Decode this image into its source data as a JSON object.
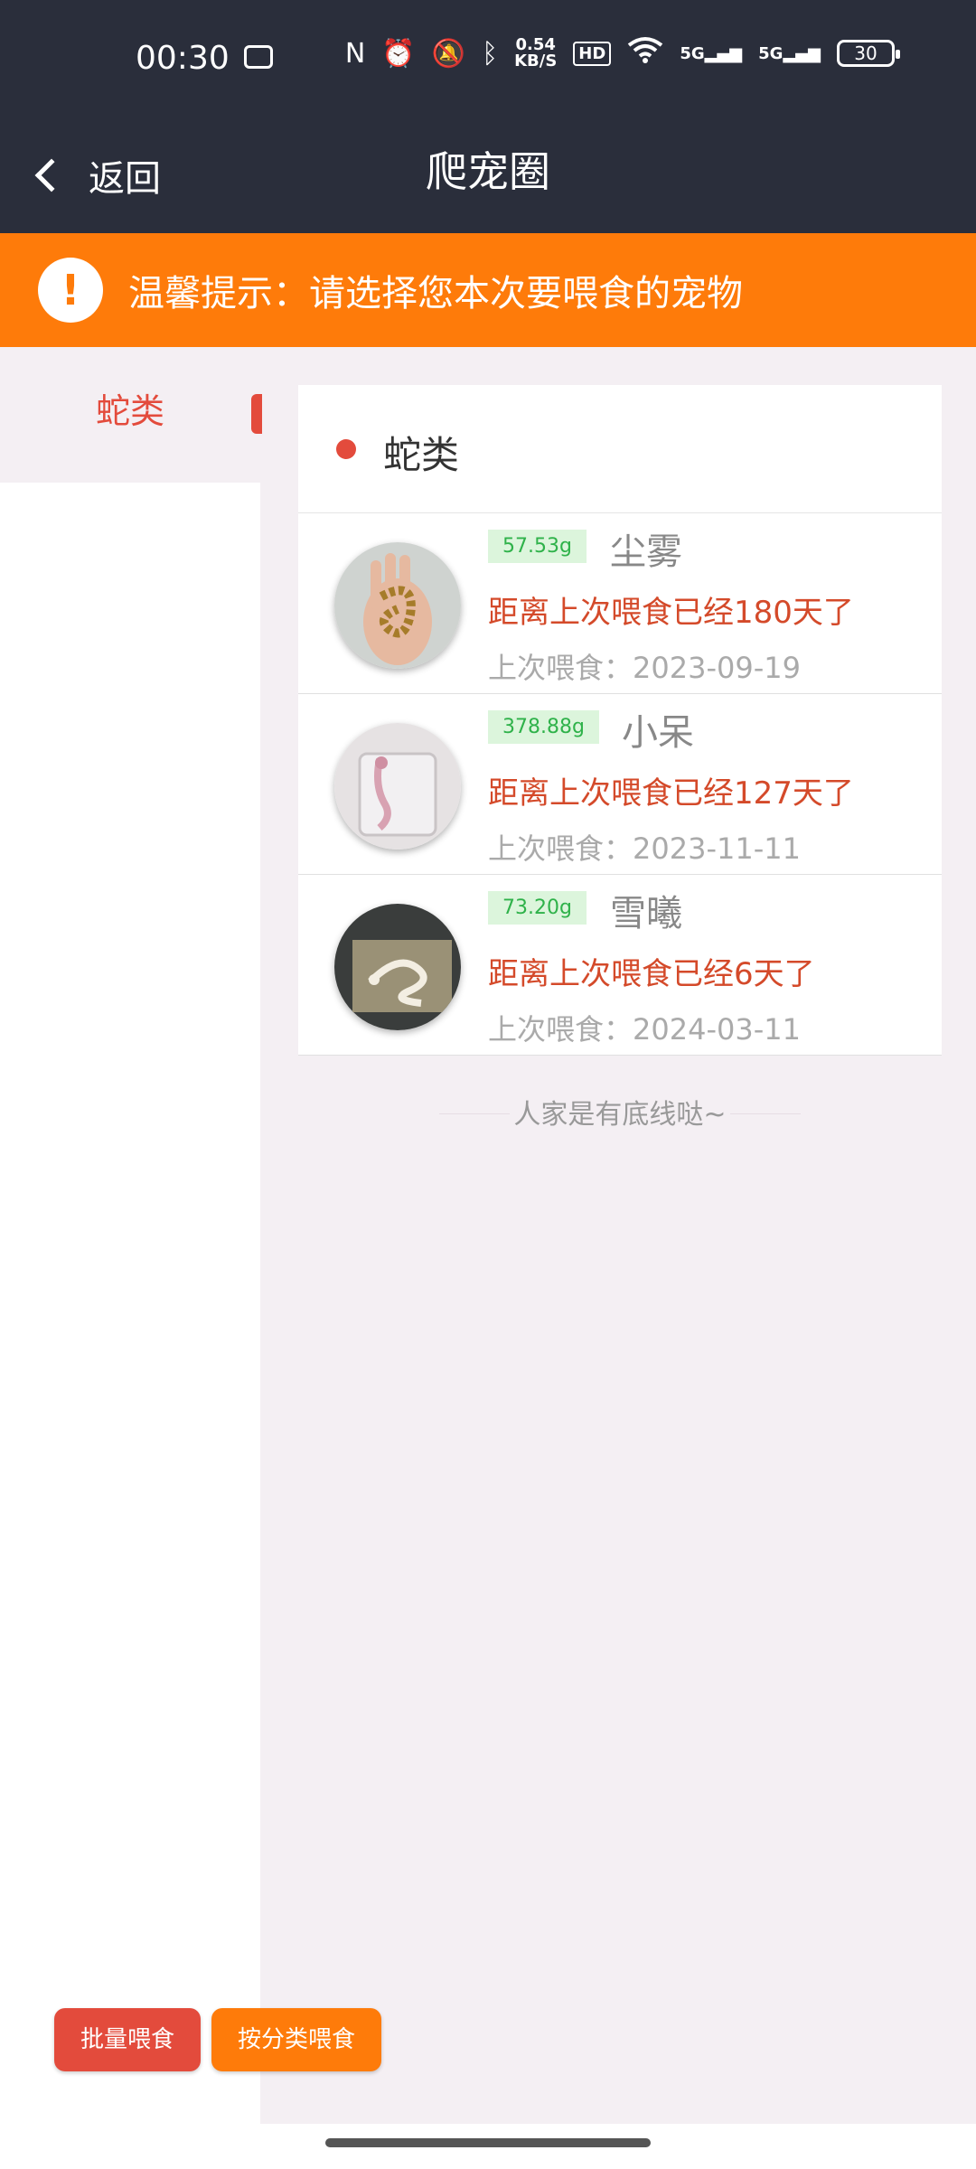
{
  "status": {
    "time": "00:30",
    "speed_top": "0.54",
    "speed_bottom": "KB/S",
    "hd": "HD",
    "signal_1": "5G",
    "signal_2": "5G",
    "battery": "30"
  },
  "nav": {
    "back_label": "返回",
    "title": "爬宠圈"
  },
  "notice": {
    "icon": "!",
    "text": "温馨提示：请选择您本次要喂食的宠物"
  },
  "sidebar": {
    "items": [
      {
        "label": "蛇类",
        "active": true
      }
    ]
  },
  "category": {
    "title": "蛇类"
  },
  "pets": [
    {
      "weight": "57.53g",
      "name": "尘雾",
      "since": "距离上次喂食已经180天了",
      "last_fed": "上次喂食：2023-09-19",
      "photo": "snake-on-hand-photo"
    },
    {
      "weight": "378.88g",
      "name": "小呆",
      "since": "距离上次喂食已经127天了",
      "last_fed": "上次喂食：2023-11-11",
      "photo": "snake-in-glass-photo"
    },
    {
      "weight": "73.20g",
      "name": "雪曦",
      "since": "距离上次喂食已经6天了",
      "last_fed": "上次喂食：2024-03-11",
      "photo": "white-snake-photo"
    }
  ],
  "list_end": "人家是有底线哒~",
  "actions": {
    "batch_feed": "批量喂食",
    "category_feed": "按分类喂食"
  },
  "colors": {
    "nav_bg": "#2a2e3b",
    "notice_bg": "#fe7b0a",
    "accent_red": "#e34b3c",
    "weight_green": "#2fb24a"
  }
}
